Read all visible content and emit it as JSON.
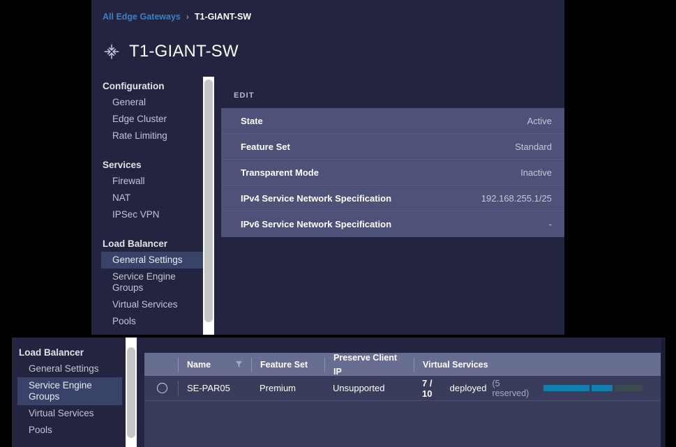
{
  "breadcrumb": {
    "root_label": "All Edge Gateways",
    "separator": "›",
    "current_label": "T1-GIANT-SW"
  },
  "header": {
    "title": "T1-GIANT-SW",
    "icon": "four-direction-arrows-icon"
  },
  "sidebar": {
    "groups": [
      {
        "label": "Configuration",
        "items": [
          "General",
          "Edge Cluster",
          "Rate Limiting"
        ]
      },
      {
        "label": "Services",
        "items": [
          "Firewall",
          "NAT",
          "IPSec VPN"
        ]
      },
      {
        "label": "Load Balancer",
        "items": [
          "General Settings",
          "Service Engine Groups",
          "Virtual Services",
          "Pools"
        ]
      }
    ],
    "selected_top": "General Settings",
    "selected_bottom": "Service Engine Groups"
  },
  "detail": {
    "edit_label": "EDIT",
    "rows": [
      {
        "key": "State",
        "value": "Active"
      },
      {
        "key": "Feature Set",
        "value": "Standard"
      },
      {
        "key": "Transparent Mode",
        "value": "Inactive"
      },
      {
        "key": "IPv4 Service Network Specification",
        "value": "192.168.255.1/25"
      },
      {
        "key": "IPv6 Service Network Specification",
        "value": "-"
      }
    ]
  },
  "table": {
    "columns": [
      "Name",
      "Feature Set",
      "Preserve Client IP",
      "Virtual Services"
    ],
    "name_filter_icon": "filter-funnel-icon",
    "rows": [
      {
        "selected": false,
        "name": "SE-PAR05",
        "feature_set": "Premium",
        "preserve_client_ip": "Unsupported",
        "vs_count": "7 / 10",
        "vs_status": "deployed",
        "vs_reserved": "(5 reserved)",
        "vs_bar": {
          "deployed_pct": 70,
          "reserved_pct": 50,
          "accent": "#1280ad",
          "track": "#3b4a4c"
        }
      }
    ]
  }
}
